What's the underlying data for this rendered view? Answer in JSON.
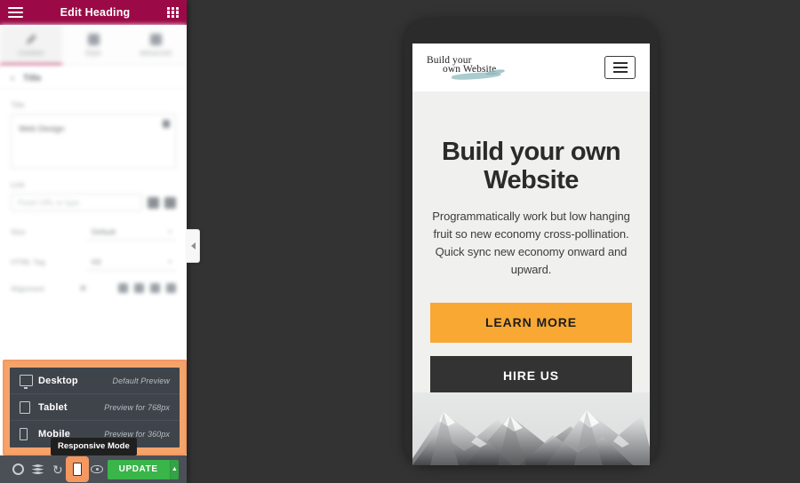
{
  "panel": {
    "header": {
      "menu_icon": "hamburger-icon",
      "title": "Edit Heading",
      "grid_icon": "grid-apps-icon"
    },
    "tabs": [
      {
        "label": "Content",
        "icon": "pencil-icon",
        "active": true
      },
      {
        "label": "Style",
        "icon": "brush-icon",
        "active": false
      },
      {
        "label": "Advanced",
        "icon": "sliders-icon",
        "active": false
      }
    ],
    "section": {
      "name": "Title",
      "chevron": "chevron-down-icon"
    },
    "fields": {
      "title_label": "Title",
      "title_value": "Web Design",
      "link_label": "Link",
      "link_placeholder": "Paste URL or type",
      "size_label": "Size",
      "size_value": "Default",
      "html_tag_label": "HTML Tag",
      "html_tag_value": "H2",
      "alignment_label": "Alignment"
    }
  },
  "responsive_menu": {
    "items": [
      {
        "name": "Desktop",
        "hint": "Default Preview",
        "icon": "desktop-icon"
      },
      {
        "name": "Tablet",
        "hint": "Preview for 768px",
        "icon": "tablet-icon"
      },
      {
        "name": "Mobile",
        "hint": "Preview for 360px",
        "icon": "mobile-icon"
      }
    ],
    "tooltip": "Responsive Mode",
    "highlight_color": "#f59860"
  },
  "toolbar": {
    "settings_icon": "gear-icon",
    "navigator_icon": "layers-icon",
    "history_icon": "history-icon",
    "responsive_icon": "mobile-icon",
    "preview_icon": "eye-icon",
    "update_label": "UPDATE",
    "update_arrow": "caret-up-icon",
    "update_color": "#39b54a"
  },
  "preview": {
    "site": {
      "logo_line1": "Build your",
      "logo_line2": "own Website",
      "menu_icon": "hamburger-icon",
      "heading": "Build your own Website",
      "paragraph": "Programmatically work but low hanging fruit so new economy cross-pollination. Quick sync new economy onward and upward.",
      "cta_primary": "LEARN MORE",
      "cta_secondary": "HIRE US",
      "image_alt": "snow-capped-mountains"
    },
    "accent_orange": "#f9a833",
    "dark_button": "#333333"
  }
}
